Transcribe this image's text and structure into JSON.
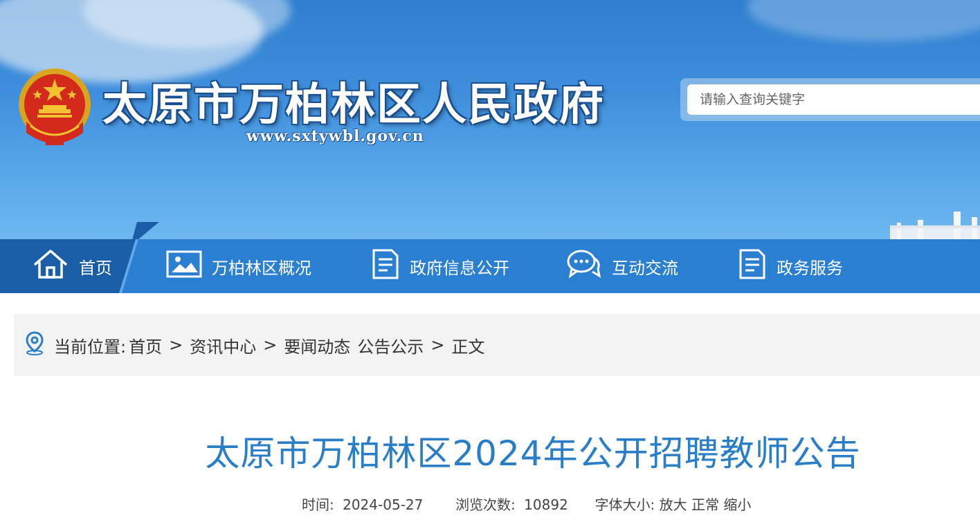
{
  "header": {
    "site_title": "太原市万柏林区人民政府",
    "site_url": "www.sxtywbl.gov.cn",
    "search_placeholder": "请输入查询关键字"
  },
  "nav": {
    "items": [
      {
        "label": "首页",
        "icon": "home-icon"
      },
      {
        "label": "万柏林区概况",
        "icon": "image-icon"
      },
      {
        "label": "政府信息公开",
        "icon": "document-icon"
      },
      {
        "label": "互动交流",
        "icon": "chat-bubbles-icon"
      },
      {
        "label": "政务服务",
        "icon": "service-doc-icon"
      }
    ]
  },
  "breadcrumb": {
    "prefix": "当前位置:",
    "items": [
      "首页",
      "资讯中心",
      "要闻动态",
      "公告公示",
      "正文"
    ],
    "sep": ">"
  },
  "article": {
    "title": "太原市万柏林区2024年公开招聘教师公告",
    "time_label": "时间:",
    "time_value": "2024-05-27",
    "views_label": "浏览次数:",
    "views_value": "10892",
    "fontsize_label": "字体大小:",
    "font_large": "放大",
    "font_normal": "正常",
    "font_small": "缩小"
  },
  "colors": {
    "nav_bg": "#2a7fd1",
    "nav_home_bg": "#1a5ea8",
    "title_color": "#2a7ec8"
  }
}
